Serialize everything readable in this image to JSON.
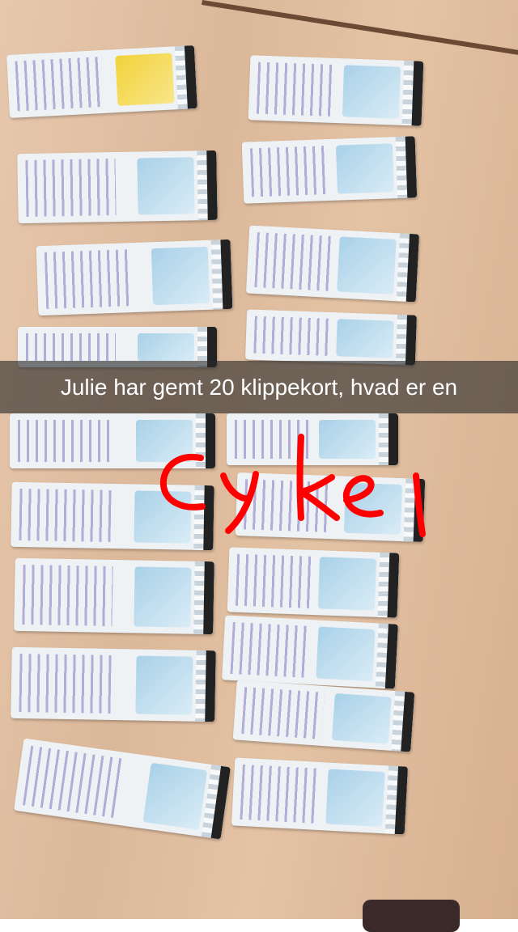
{
  "snap": {
    "caption": "Julie har gemt 20 klippekort, hvad er en",
    "drawing_text": "cykel",
    "drawing_color": "#ff0000"
  },
  "tickets": [
    {
      "type": "yellow"
    },
    {
      "type": "blue"
    },
    {
      "type": "blue"
    },
    {
      "type": "blue"
    },
    {
      "type": "blue"
    },
    {
      "type": "blue"
    },
    {
      "type": "blue"
    },
    {
      "type": "blue"
    },
    {
      "type": "blue"
    },
    {
      "type": "blue"
    },
    {
      "type": "blue"
    },
    {
      "type": "blue"
    },
    {
      "type": "blue"
    },
    {
      "type": "blue"
    },
    {
      "type": "blue"
    },
    {
      "type": "blue"
    },
    {
      "type": "blue"
    },
    {
      "type": "blue"
    },
    {
      "type": "blue"
    },
    {
      "type": "blue"
    }
  ]
}
